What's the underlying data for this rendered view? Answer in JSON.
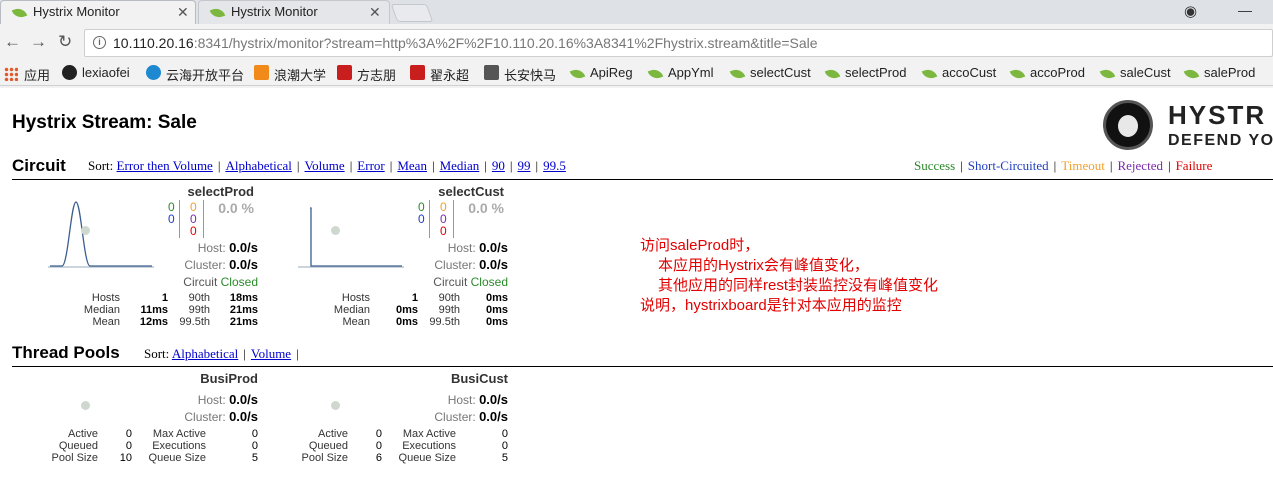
{
  "browser": {
    "tabs": [
      {
        "title": "Hystrix Monitor",
        "active": true
      },
      {
        "title": "Hystrix Monitor",
        "active": false
      }
    ],
    "url_host": "10.110.20.16",
    "url_rest": ":8341/hystrix/monitor?stream=http%3A%2F%2F10.110.20.16%3A8341%2Fhystrix.stream&title=Sale",
    "bookmarks": [
      {
        "label": "应用",
        "icon": "apps-icon"
      },
      {
        "label": "lexiaofei",
        "icon": "github-icon"
      },
      {
        "label": "云海开放平台",
        "icon": "cloud-icon"
      },
      {
        "label": "浪潮大学",
        "icon": "orange-icon"
      },
      {
        "label": "方志朋",
        "icon": "csdn-icon"
      },
      {
        "label": "翟永超",
        "icon": "csdn-icon"
      },
      {
        "label": "长安快马",
        "icon": "horse-icon"
      },
      {
        "label": "ApiReg",
        "icon": "leaf-icon"
      },
      {
        "label": "AppYml",
        "icon": "leaf-icon"
      },
      {
        "label": "selectCust",
        "icon": "leaf-icon"
      },
      {
        "label": "selectProd",
        "icon": "leaf-icon"
      },
      {
        "label": "accoCust",
        "icon": "leaf-icon"
      },
      {
        "label": "accoProd",
        "icon": "leaf-icon"
      },
      {
        "label": "saleCust",
        "icon": "leaf-icon"
      },
      {
        "label": "saleProd",
        "icon": "leaf-icon"
      }
    ]
  },
  "page": {
    "title": "Hystrix Stream: Sale",
    "logo_text": "HYSTR",
    "logo_sub": "DEFEND YO"
  },
  "circuit": {
    "title": "Circuit",
    "sort_label": "Sort:",
    "sort_links": [
      "Error then Volume",
      "Alphabetical",
      "Volume",
      "Error",
      "Mean",
      "Median",
      "90",
      "99",
      "99.5"
    ],
    "legend": [
      {
        "label": "Success",
        "color": "#2a8a2a"
      },
      {
        "label": "Short-Circuited",
        "color": "#1f3fbf"
      },
      {
        "label": "Timeout",
        "color": "#f0a030"
      },
      {
        "label": "Rejected",
        "color": "#7a2aa8"
      },
      {
        "label": "Failure",
        "color": "#e00000"
      }
    ],
    "cards": [
      {
        "name": "selectProd",
        "success": "0",
        "short": "0",
        "timeout": "0",
        "rejected": "0",
        "failure": "0",
        "error_pct": "0.0 %",
        "host_label": "Host:",
        "host": "0.0/s",
        "cluster_label": "Cluster:",
        "cluster": "0.0/s",
        "circuit_label": "Circuit",
        "circuit_state": "Closed",
        "hosts_label": "Hosts",
        "hosts": "1",
        "median_label": "Median",
        "median": "11ms",
        "mean_label": "Mean",
        "mean": "12ms",
        "p90_label": "90th",
        "p90": "18ms",
        "p99_label": "99th",
        "p99": "21ms",
        "p995_label": "99.5th",
        "p995": "21ms",
        "spark": "peak"
      },
      {
        "name": "selectCust",
        "success": "0",
        "short": "0",
        "timeout": "0",
        "rejected": "0",
        "failure": "0",
        "error_pct": "0.0 %",
        "host_label": "Host:",
        "host": "0.0/s",
        "cluster_label": "Cluster:",
        "cluster": "0.0/s",
        "circuit_label": "Circuit",
        "circuit_state": "Closed",
        "hosts_label": "Hosts",
        "hosts": "1",
        "median_label": "Median",
        "median": "0ms",
        "mean_label": "Mean",
        "mean": "0ms",
        "p90_label": "90th",
        "p90": "0ms",
        "p99_label": "99th",
        "p99": "0ms",
        "p995_label": "99.5th",
        "p995": "0ms",
        "spark": "flat"
      }
    ]
  },
  "annotation": {
    "line1": "访问saleProd时，",
    "line2": "本应用的Hystrix会有峰值变化，",
    "line3": "其他应用的同样rest封装监控没有峰值变化",
    "line4": "说明，hystrixboard是针对本应用的监控"
  },
  "thread_pools": {
    "title": "Thread Pools",
    "sort_label": "Sort:",
    "sort_links": [
      "Alphabetical",
      "Volume"
    ],
    "cards": [
      {
        "name": "BusiProd",
        "host_label": "Host:",
        "host": "0.0/s",
        "cluster_label": "Cluster:",
        "cluster": "0.0/s",
        "active_label": "Active",
        "active": "0",
        "queued_label": "Queued",
        "queued": "0",
        "poolsize_label": "Pool Size",
        "poolsize": "10",
        "maxactive_label": "Max Active",
        "maxactive": "0",
        "executions_label": "Executions",
        "executions": "0",
        "queuesize_label": "Queue Size",
        "queuesize": "5"
      },
      {
        "name": "BusiCust",
        "host_label": "Host:",
        "host": "0.0/s",
        "cluster_label": "Cluster:",
        "cluster": "0.0/s",
        "active_label": "Active",
        "active": "0",
        "queued_label": "Queued",
        "queued": "0",
        "poolsize_label": "Pool Size",
        "poolsize": "6",
        "maxactive_label": "Max Active",
        "maxactive": "0",
        "executions_label": "Executions",
        "executions": "0",
        "queuesize_label": "Queue Size",
        "queuesize": "5"
      }
    ]
  }
}
